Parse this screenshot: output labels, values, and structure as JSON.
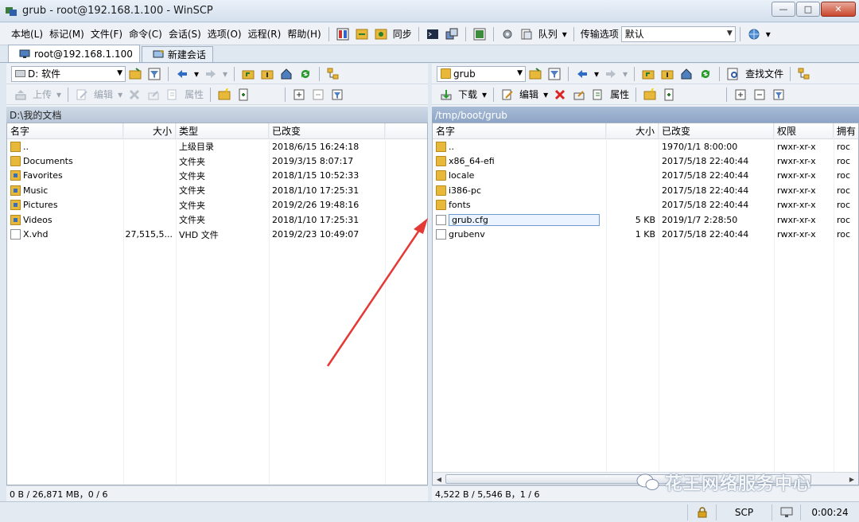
{
  "window": {
    "title": "grub - root@192.168.1.100 - WinSCP",
    "minimize": "—",
    "maximize": "□",
    "close": "✕"
  },
  "menu": {
    "items": [
      "本地(L)",
      "标记(M)",
      "文件(F)",
      "命令(C)",
      "会话(S)",
      "选项(O)",
      "远程(R)",
      "帮助(H)"
    ],
    "sync_label": "同步",
    "queue_label": "队列",
    "transfer_label": "传输选项",
    "transfer_value": "默认"
  },
  "tabs": [
    {
      "label": "root@192.168.1.100"
    },
    {
      "label": "新建会话"
    }
  ],
  "left": {
    "drive": "D: 软件",
    "upload": "上传",
    "edit": "编辑",
    "properties": "属性",
    "path": "D:\\我的文档",
    "headers": [
      "名字",
      "大小",
      "类型",
      "已改变"
    ],
    "rows": [
      {
        "name": "..",
        "size": "",
        "type": "上级目录",
        "changed": "2018/6/15  16:24:18",
        "icon": "folder-up"
      },
      {
        "name": "Documents",
        "size": "",
        "type": "文件夹",
        "changed": "2019/3/15  8:07:17",
        "icon": "folder"
      },
      {
        "name": "Favorites",
        "size": "",
        "type": "文件夹",
        "changed": "2018/1/15  10:52:33",
        "icon": "special"
      },
      {
        "name": "Music",
        "size": "",
        "type": "文件夹",
        "changed": "2018/1/10  17:25:31",
        "icon": "special"
      },
      {
        "name": "Pictures",
        "size": "",
        "type": "文件夹",
        "changed": "2019/2/26  19:48:16",
        "icon": "special"
      },
      {
        "name": "Videos",
        "size": "",
        "type": "文件夹",
        "changed": "2018/1/10  17:25:31",
        "icon": "special"
      },
      {
        "name": "X.vhd",
        "size": "27,515,5...",
        "type": "VHD 文件",
        "changed": "2019/2/23  10:49:07",
        "icon": "file"
      }
    ],
    "status": "0 B / 26,871 MB，0 / 6"
  },
  "right": {
    "folder": "grub",
    "find": "查找文件",
    "download": "下载",
    "edit": "编辑",
    "properties": "属性",
    "path": "/tmp/boot/grub",
    "headers": [
      "名字",
      "大小",
      "已改变",
      "权限",
      "拥有"
    ],
    "rows": [
      {
        "name": "..",
        "size": "",
        "changed": "1970/1/1 8:00:00",
        "rights": "rwxr-xr-x",
        "owner": "roc",
        "icon": "folder-up",
        "selected": false
      },
      {
        "name": "x86_64-efi",
        "size": "",
        "changed": "2017/5/18 22:40:44",
        "rights": "rwxr-xr-x",
        "owner": "roc",
        "icon": "folder",
        "selected": false
      },
      {
        "name": "locale",
        "size": "",
        "changed": "2017/5/18 22:40:44",
        "rights": "rwxr-xr-x",
        "owner": "roc",
        "icon": "folder",
        "selected": false
      },
      {
        "name": "i386-pc",
        "size": "",
        "changed": "2017/5/18 22:40:44",
        "rights": "rwxr-xr-x",
        "owner": "roc",
        "icon": "folder",
        "selected": false
      },
      {
        "name": "fonts",
        "size": "",
        "changed": "2017/5/18 22:40:44",
        "rights": "rwxr-xr-x",
        "owner": "roc",
        "icon": "folder",
        "selected": false
      },
      {
        "name": "grub.cfg",
        "size": "5 KB",
        "changed": "2019/1/7 2:28:50",
        "rights": "rwxr-xr-x",
        "owner": "roc",
        "icon": "file",
        "selected": true
      },
      {
        "name": "grubenv",
        "size": "1 KB",
        "changed": "2017/5/18 22:40:44",
        "rights": "rwxr-xr-x",
        "owner": "roc",
        "icon": "file",
        "selected": false
      }
    ],
    "status": "4,522 B / 5,546 B，1 / 6"
  },
  "bottombar": {
    "protocol": "SCP",
    "elapsed": "0:00:24"
  },
  "watermark": "花王网络服务中心",
  "colors": {
    "arrow": "#e53935",
    "folder": "#e8b83a",
    "path_active": "#8ba3c5"
  }
}
